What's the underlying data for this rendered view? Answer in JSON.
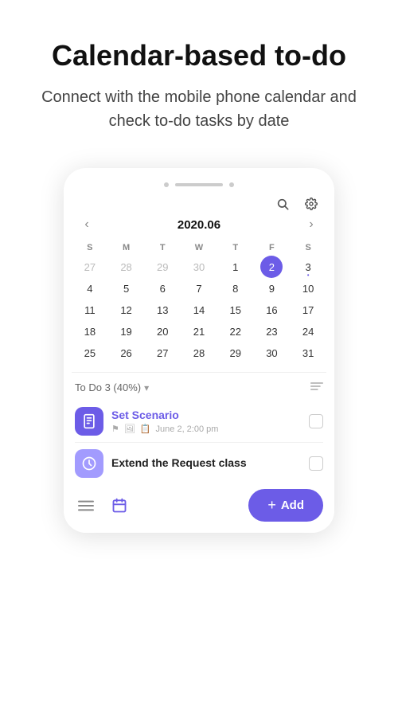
{
  "header": {
    "title": "Calendar-based to-do",
    "subtitle": "Connect with the mobile phone calendar and check to-do tasks by date"
  },
  "mockup": {
    "top_bar_dot1": "",
    "top_bar_dot2": "",
    "top_bar_line": ""
  },
  "calendar": {
    "month_year": "2020.06",
    "prev_label": "‹",
    "next_label": "›",
    "search_icon": "🔍",
    "settings_icon": "⚙",
    "day_headers": [
      "S",
      "M",
      "T",
      "W",
      "T",
      "F",
      "S"
    ],
    "weeks": [
      [
        "27",
        "28",
        "29",
        "30",
        "1",
        "2",
        "3"
      ],
      [
        "4",
        "5",
        "6",
        "7",
        "8",
        "9",
        "10"
      ],
      [
        "11",
        "12",
        "13",
        "14",
        "15",
        "16",
        "17"
      ],
      [
        "18",
        "19",
        "20",
        "21",
        "22",
        "23",
        "24"
      ],
      [
        "25",
        "26",
        "27",
        "28",
        "29",
        "30",
        "31"
      ]
    ],
    "other_month_days": [
      "27",
      "28",
      "29",
      "30"
    ],
    "today": "2",
    "has_dot": "3"
  },
  "todo": {
    "label": "To Do 3 (40%)",
    "chevron": "▾",
    "sort_icon": "≡",
    "items": [
      {
        "id": 1,
        "title": "Set Scenario",
        "meta_icons": [
          "📄",
          "📷",
          "📋"
        ],
        "date": "June 2, 2:00 pm",
        "avatar_type": "clipboard",
        "color": "purple"
      },
      {
        "id": 2,
        "title": "Extend the Request class",
        "meta_icons": [],
        "date": "",
        "avatar_type": "clock",
        "color": "light-purple"
      }
    ]
  },
  "bottom_bar": {
    "list_icon": "≡",
    "calendar_icon": "📅",
    "add_label": "Add",
    "add_plus": "+"
  }
}
